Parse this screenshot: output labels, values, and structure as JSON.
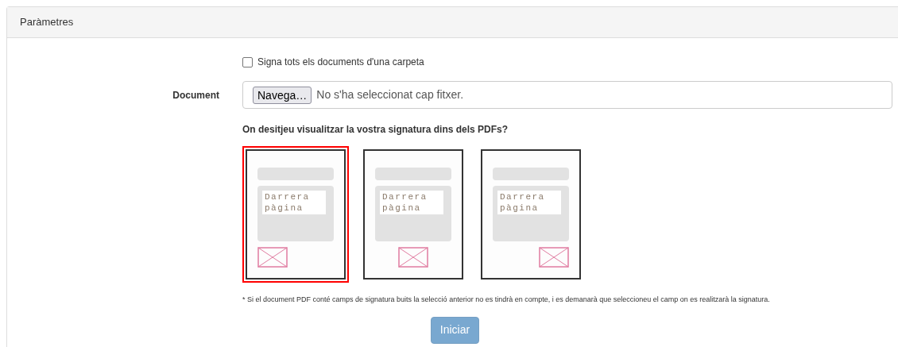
{
  "panel": {
    "title": "Paràmetres"
  },
  "folder_checkbox": {
    "label": "Signa tots els documents d'una carpeta",
    "checked": false
  },
  "document": {
    "label": "Document",
    "button": "Navega…",
    "value": "No s'ha seleccionat cap fitxer."
  },
  "question": "On desitjeu visualitzar la vostra signatura dins dels PDFs?",
  "options": [
    {
      "kind": "left",
      "label": "Darrera pàgina",
      "selected": true
    },
    {
      "kind": "center",
      "label": "Darrera pàgina",
      "selected": false
    },
    {
      "kind": "right",
      "label": "Darrera pàgina",
      "selected": false
    }
  ],
  "footnote": "* Si el document PDF conté camps de signatura buits la selecció anterior no es tindrà en compte, i es demanarà que seleccioneu el camp on es realitzarà la signatura.",
  "submit": {
    "label": "Iniciar",
    "disabled": true
  }
}
